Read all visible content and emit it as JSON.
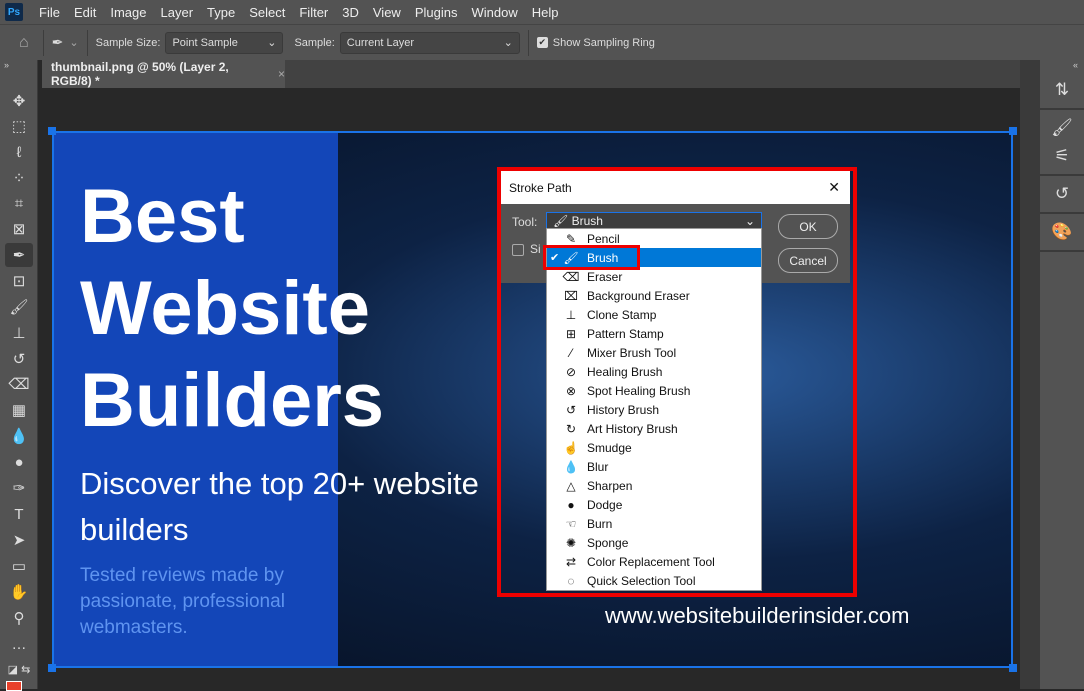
{
  "app": {
    "logo": "Ps"
  },
  "menu": [
    "File",
    "Edit",
    "Image",
    "Layer",
    "Type",
    "Select",
    "Filter",
    "3D",
    "View",
    "Plugins",
    "Window",
    "Help"
  ],
  "options": {
    "sample_size_label": "Sample Size:",
    "sample_size_value": "Point Sample",
    "sample_label": "Sample:",
    "sample_value": "Current Layer",
    "show_ring_label": "Show Sampling Ring",
    "show_ring_checked": true
  },
  "tab": {
    "title": "thumbnail.png @ 50% (Layer 2, RGB/8) *",
    "close": "×"
  },
  "image": {
    "headline_lines": [
      "Best",
      "Website",
      "Builders"
    ],
    "subhead": "Discover the top 20+ website builders",
    "tagline": "Tested reviews made by passionate, professional webmasters.",
    "url": "www.websitebuilderinsider.com"
  },
  "dialog": {
    "title": "Stroke Path",
    "close": "✕",
    "tool_label": "Tool:",
    "tool_value": "Brush",
    "simulate_label": "Si",
    "ok": "OK",
    "cancel": "Cancel",
    "options": [
      {
        "label": "Pencil",
        "icon": "✎"
      },
      {
        "label": "Brush",
        "icon": "🖌",
        "selected": true
      },
      {
        "label": "Eraser",
        "icon": "⌫"
      },
      {
        "label": "Background Eraser",
        "icon": "⌧"
      },
      {
        "label": "Clone Stamp",
        "icon": "⊥"
      },
      {
        "label": "Pattern Stamp",
        "icon": "⊞"
      },
      {
        "label": "Mixer Brush Tool",
        "icon": "⁄"
      },
      {
        "label": "Healing Brush",
        "icon": "⊘"
      },
      {
        "label": "Spot Healing Brush",
        "icon": "⊗"
      },
      {
        "label": "History Brush",
        "icon": "↺"
      },
      {
        "label": "Art History Brush",
        "icon": "↻"
      },
      {
        "label": "Smudge",
        "icon": "☝"
      },
      {
        "label": "Blur",
        "icon": "💧"
      },
      {
        "label": "Sharpen",
        "icon": "△"
      },
      {
        "label": "Dodge",
        "icon": "●"
      },
      {
        "label": "Burn",
        "icon": "☜"
      },
      {
        "label": "Sponge",
        "icon": "✺"
      },
      {
        "label": "Color Replacement Tool",
        "icon": "⇄"
      },
      {
        "label": "Quick Selection Tool",
        "icon": "◌"
      }
    ]
  },
  "colors": {
    "accent": "#1a73e8",
    "highlight": "#e00000",
    "selection": "#0078d7",
    "foreground": "#e8402a"
  }
}
